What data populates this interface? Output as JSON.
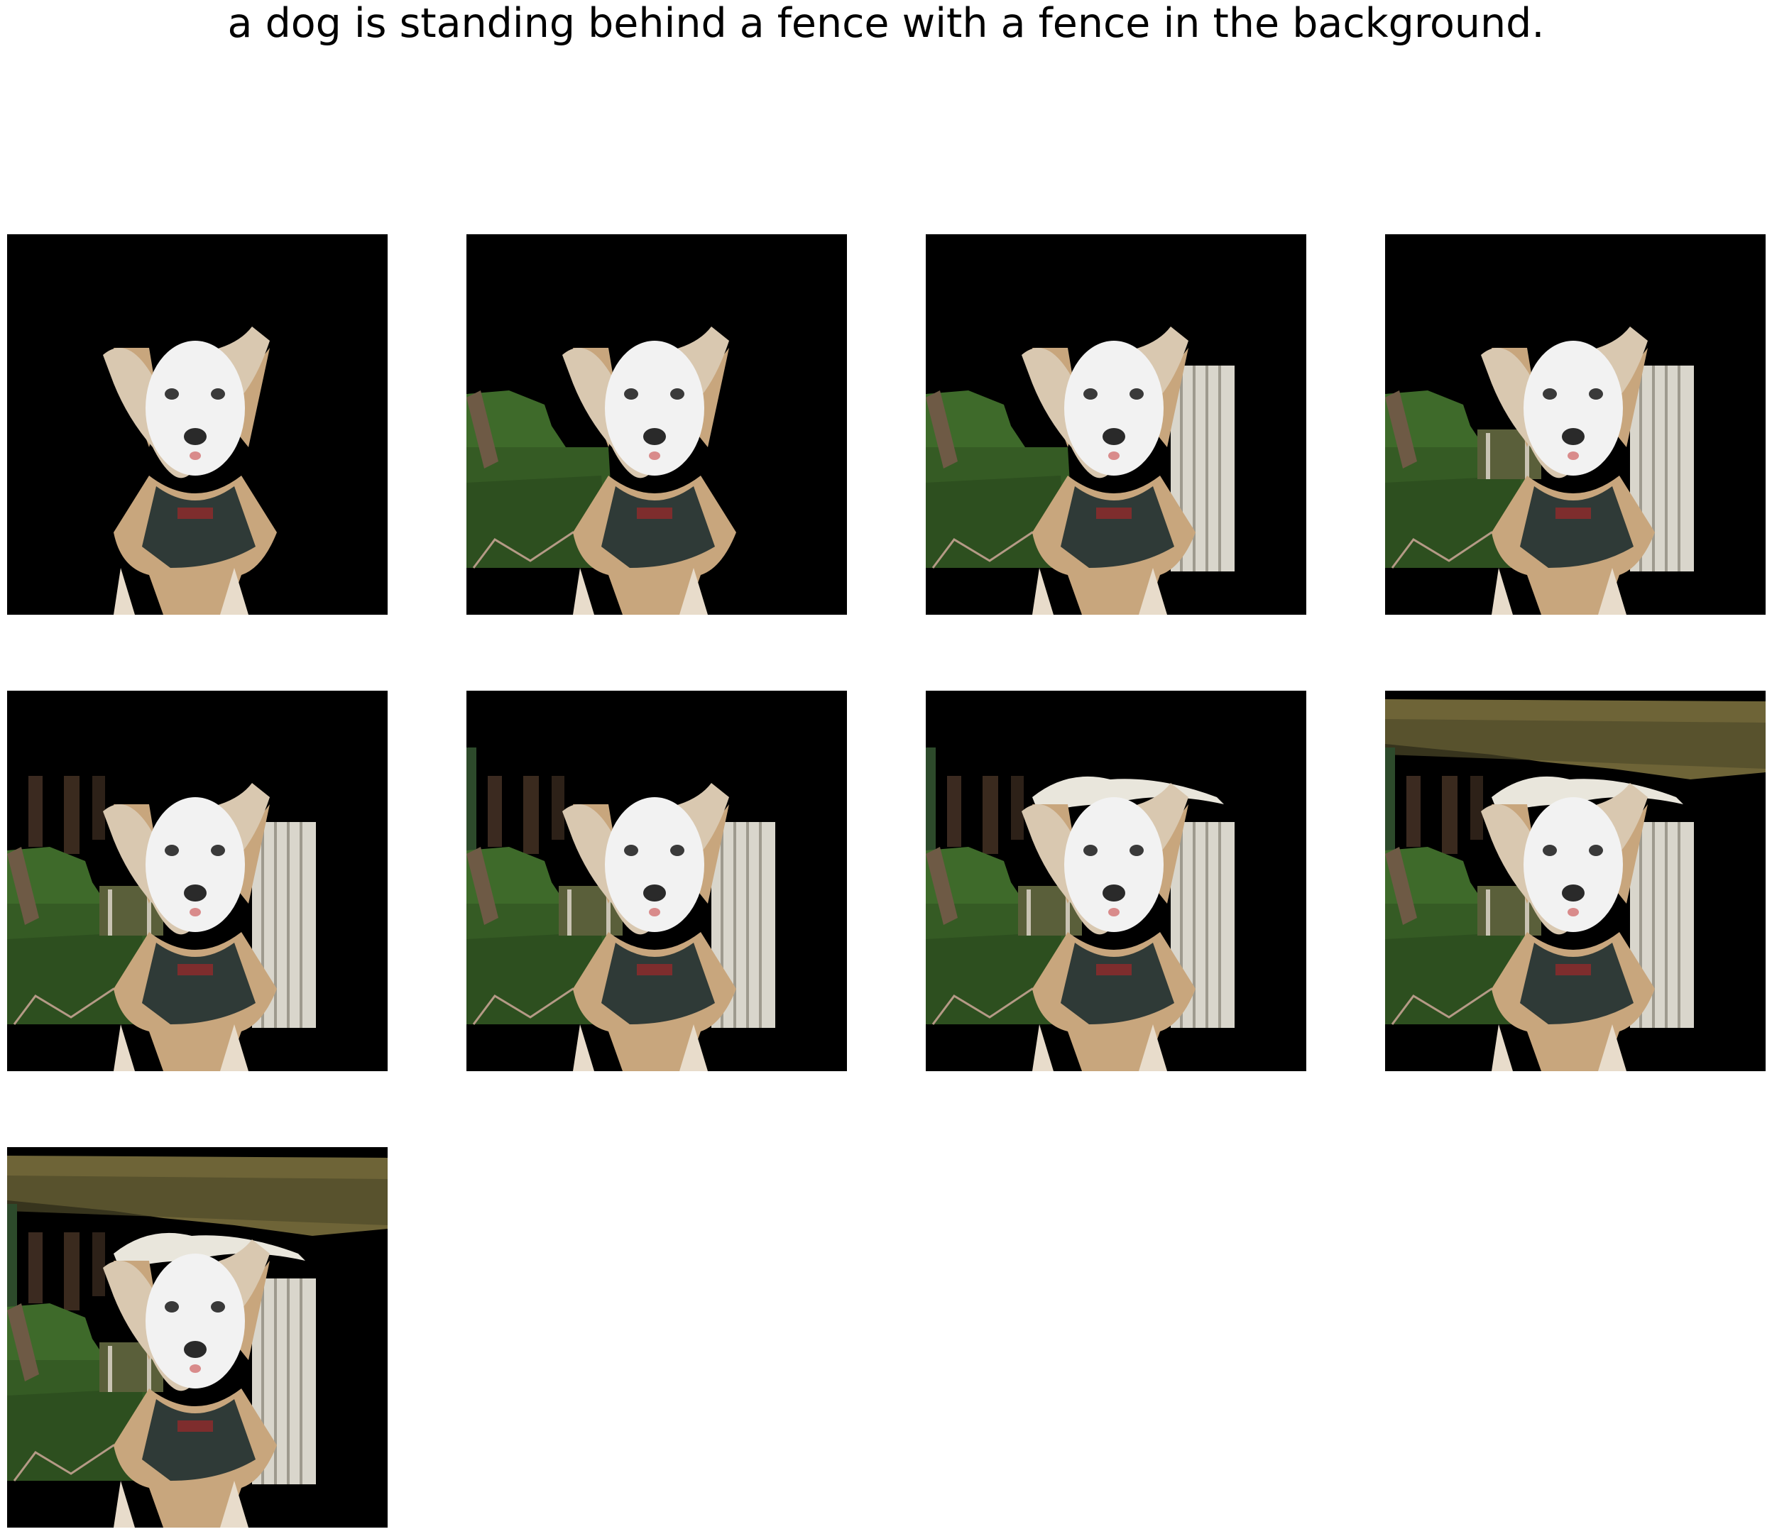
{
  "caption": "a dog is standing behind a fence with a fence in the background.",
  "panels": [
    {
      "name": "panel-1",
      "layers": [
        "dog"
      ]
    },
    {
      "name": "panel-2",
      "layers": [
        "dog",
        "grass-left"
      ]
    },
    {
      "name": "panel-3",
      "layers": [
        "dog",
        "grass-left",
        "fence-right"
      ]
    },
    {
      "name": "panel-4",
      "layers": [
        "dog",
        "grass-left",
        "fence-right",
        "fence-mid"
      ]
    },
    {
      "name": "panel-5",
      "layers": [
        "dog",
        "grass-left",
        "fence-right",
        "fence-mid",
        "posts-left"
      ]
    },
    {
      "name": "panel-6",
      "layers": [
        "dog",
        "grass-left",
        "fence-right",
        "fence-mid",
        "posts-left",
        "pole-edge"
      ]
    },
    {
      "name": "panel-7",
      "layers": [
        "dog",
        "grass-left",
        "fence-right",
        "fence-mid",
        "posts-left",
        "pole-edge",
        "sky-top-dog"
      ]
    },
    {
      "name": "panel-8",
      "layers": [
        "dog",
        "grass-left",
        "fence-right",
        "fence-mid",
        "posts-left",
        "pole-edge",
        "sky-top-dog",
        "bushes-top"
      ]
    },
    {
      "name": "panel-9",
      "layers": [
        "dog",
        "grass-left",
        "fence-right",
        "fence-mid",
        "posts-left",
        "pole-edge",
        "sky-top-dog",
        "bushes-top"
      ]
    }
  ],
  "colors": {
    "background": "#000000",
    "grass": "#3e6a2a",
    "fence": "#d9d6cc",
    "dog_face": "#f2f2f2",
    "dog_tan": "#c8a67d",
    "harness": "#2f3a37",
    "bushes": "#6e6437"
  }
}
